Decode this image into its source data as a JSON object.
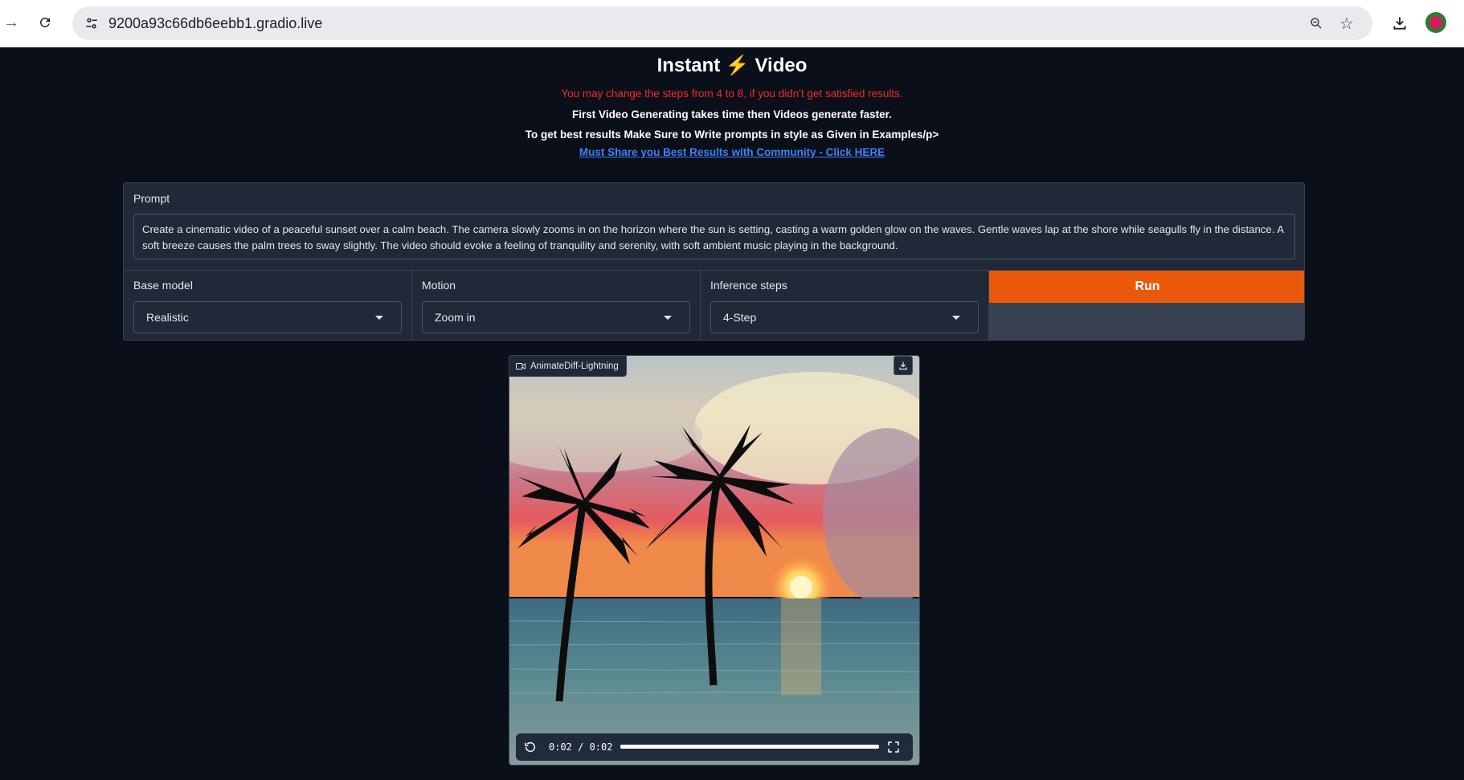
{
  "browser": {
    "url": "9200a93c66db6eebb1.gradio.live"
  },
  "page": {
    "title_left": "Instant",
    "title_icon": "⚡",
    "title_right": "Video",
    "note_red": "You may change the steps from 4 to 8, if you didn't get satisfied results.",
    "note_1": "First Video Generating takes time then Videos generate faster.",
    "note_2": "To get best results Make Sure to Write prompts in style as Given in Examples/p>",
    "community_link": "Must Share you Best Results with Community - Click HERE"
  },
  "form": {
    "prompt_label": "Prompt",
    "prompt_value": "Create a cinematic video of a peaceful sunset over a calm beach. The camera slowly zooms in on the horizon where the sun is setting, casting a warm golden glow on the waves. Gentle waves lap at the shore while seagulls fly in the distance. A soft breeze causes the palm trees to sway slightly. The video should evoke a feeling of tranquility and serenity, with soft ambient music playing in the background.",
    "base_model_label": "Base model",
    "base_model_value": "Realistic",
    "motion_label": "Motion",
    "motion_value": "Zoom in",
    "steps_label": "Inference steps",
    "steps_value": "4-Step",
    "run_label": "Run"
  },
  "video": {
    "label": "AnimateDiff-Lightning",
    "time": "0:02 / 0:02",
    "progress": 1.0
  },
  "colors": {
    "accent": "#ea580c",
    "warning": "#ef2b2b",
    "link": "#3b82f6",
    "background": "#0b0f19"
  }
}
